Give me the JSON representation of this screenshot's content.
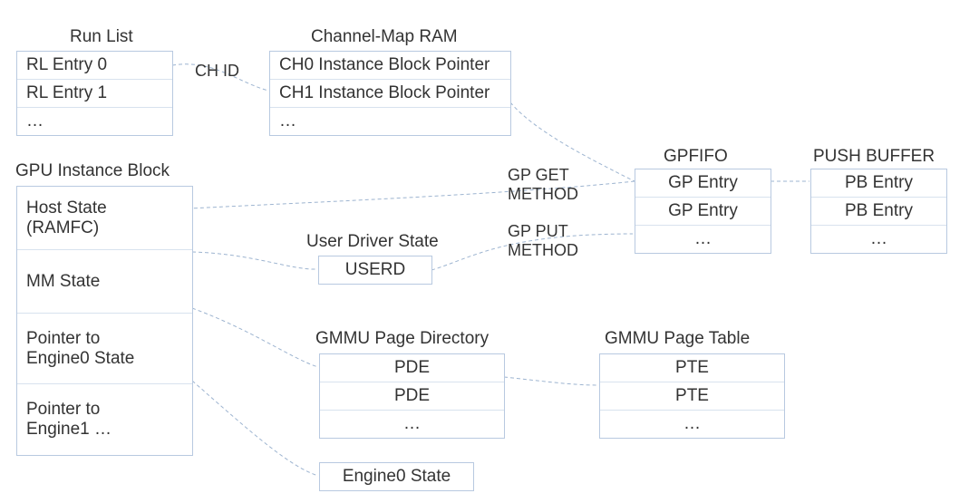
{
  "runlist": {
    "title": "Run List",
    "rows": [
      "RL Entry 0",
      "RL Entry 1",
      "…"
    ]
  },
  "chmap": {
    "title": "Channel-Map RAM",
    "rows": [
      "CH0 Instance Block Pointer",
      "CH1 Instance Block Pointer",
      "…"
    ]
  },
  "instblock": {
    "title": "GPU Instance Block",
    "rows": [
      "Host State (RAMFC)",
      "MM State",
      "Pointer to Engine0 State",
      "Pointer to Engine1 …"
    ]
  },
  "userd": {
    "title": "User Driver State",
    "rows": [
      "USERD"
    ]
  },
  "gpfifo": {
    "title": "GPFIFO",
    "rows": [
      "GP Entry",
      "GP Entry",
      "…"
    ]
  },
  "pushbuf": {
    "title": "PUSH BUFFER",
    "rows": [
      "PB Entry",
      "PB Entry",
      "…"
    ]
  },
  "pd": {
    "title": "GMMU Page Directory",
    "rows": [
      "PDE",
      "PDE",
      "…"
    ]
  },
  "pt": {
    "title": "GMMU Page Table",
    "rows": [
      "PTE",
      "PTE",
      "…"
    ]
  },
  "engine0": {
    "rows": [
      "Engine0 State"
    ]
  },
  "labels": {
    "chid": "CH ID",
    "gpget": "GP GET METHOD",
    "gpput": "GP PUT METHOD"
  }
}
